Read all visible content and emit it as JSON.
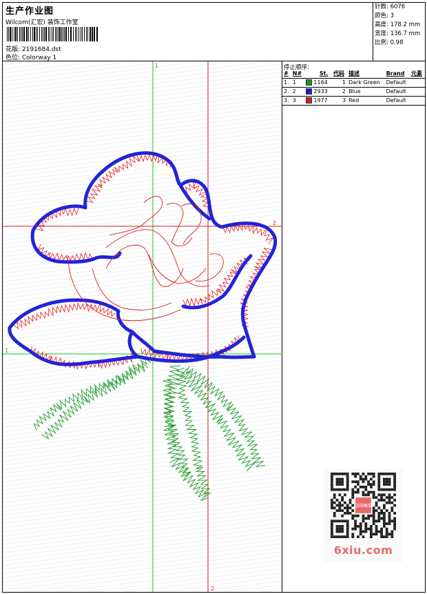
{
  "header": {
    "title": "生产作业图",
    "studio": "Wilcom(汇宏) 装饰工作室",
    "design_label": "花版: 2191684.dst",
    "colorway_label": "色位: Colorway 1"
  },
  "stats": {
    "stitches": "针数: 6076",
    "colors": "颜色: 3",
    "height": "高度: 178.2 mm",
    "width": "宽度: 136.7 mm",
    "scale": "比例: 0.98"
  },
  "guides": {
    "green_top": "1",
    "green_left": "1",
    "red_right": "2",
    "red_bottom": "2"
  },
  "stop_sequence": {
    "title": "停止顺序:",
    "columns": [
      "#",
      "N#",
      "St.",
      "代码",
      "描述",
      "Brand",
      "元素"
    ],
    "rows": [
      {
        "idx": "1.",
        "n": "1",
        "color": "#139a1f",
        "st": "1164",
        "code": "1",
        "desc": "Dark Green",
        "brand": "Default"
      },
      {
        "idx": "2.",
        "n": "2",
        "color": "#1a1adb",
        "st": "2933",
        "code": "2",
        "desc": "Blue",
        "brand": "Default"
      },
      {
        "idx": "3.",
        "n": "3",
        "color": "#e01b1b",
        "st": "1977",
        "code": "3",
        "desc": "Red",
        "brand": "Default"
      }
    ]
  },
  "colors": {
    "green_stitch": "#1f9a2a",
    "blue_stitch": "#2323d8",
    "red_stitch": "#e01a1a",
    "guide_green": "#19c419",
    "guide_red": "#d81c1c"
  },
  "watermark": {
    "site": "6xiu.com",
    "badge": "汉印图库"
  }
}
